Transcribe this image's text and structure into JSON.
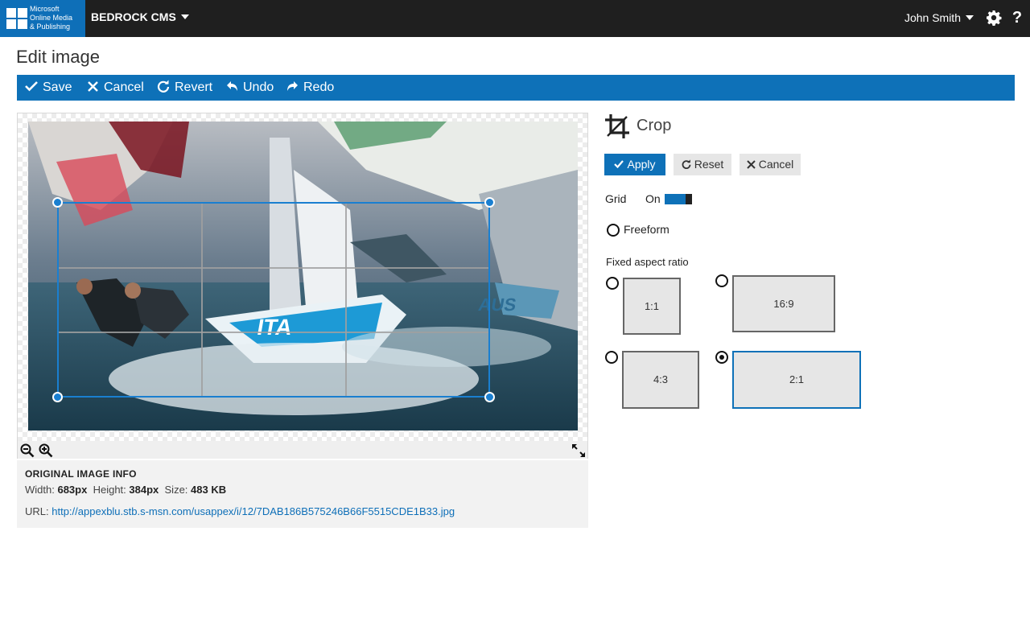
{
  "brand": {
    "line1": "Microsoft",
    "line2": "Online Media",
    "line3": "& Publishing",
    "color": "#0e6fb8"
  },
  "header": {
    "app_name": "BEDROCK CMS",
    "user_name": "John Smith",
    "settings_icon": "gear-icon",
    "help_label": "?"
  },
  "page": {
    "title": "Edit image"
  },
  "toolbar": {
    "save": "Save",
    "cancel": "Cancel",
    "revert": "Revert",
    "undo": "Undo",
    "redo": "Redo",
    "color": "#0e71b8"
  },
  "image_info": {
    "heading": "ORIGINAL IMAGE INFO",
    "width_label": "Width:",
    "width_value": "683px",
    "height_label": "Height:",
    "height_value": "384px",
    "size_label": "Size:",
    "size_value": "483 KB",
    "url_label": "URL:",
    "url_value": "http://appexblu.stb.s-msn.com/usappex/i/12/7DAB186B575246B66F5515CDE1B33.jpg"
  },
  "crop_panel": {
    "title": "Crop",
    "apply": "Apply",
    "reset": "Reset",
    "cancel": "Cancel",
    "grid_label": "Grid",
    "grid_state": "On",
    "freeform_label": "Freeform",
    "fixed_ratio_label": "Fixed aspect ratio",
    "ratios": [
      "1:1",
      "16:9",
      "4:3",
      "2:1"
    ],
    "selected_ratio": "2:1"
  }
}
